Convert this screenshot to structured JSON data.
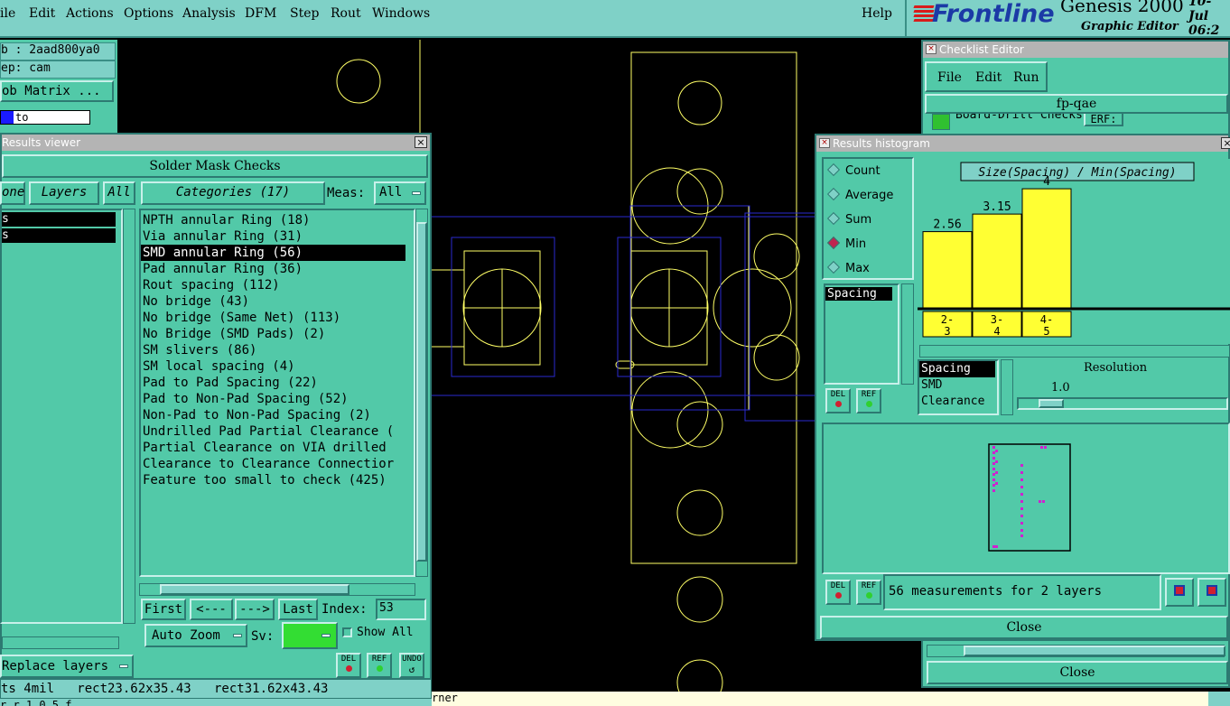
{
  "menu": {
    "items": [
      "ile",
      "Edit",
      "Actions",
      "Options",
      "Analysis",
      "DFM",
      "Step",
      "Rout",
      "Windows"
    ],
    "help": "Help"
  },
  "brand": {
    "logo": "Frontline",
    "product": "Genesis 2000",
    "subtitle": "Graphic Editor",
    "date_line1": "10-Jul",
    "date_line2": "06:2"
  },
  "left_panel": {
    "job": "b : 2aad800ya0",
    "step": "ep: cam",
    "matrix_button": "ob Matrix ...",
    "to_label": "to"
  },
  "results_viewer": {
    "title": "Results viewer",
    "heading": "Solder Mask Checks",
    "tabs": [
      "one",
      "Layers",
      "All"
    ],
    "categories_button": "Categories (17)",
    "meas_label": "Meas:",
    "meas_value": "All",
    "left_rows": [
      "s",
      "s"
    ],
    "categories": [
      "NPTH annular Ring (18)",
      "Via annular Ring (31)",
      "SMD annular Ring (56)",
      "Pad annular Ring (36)",
      "Rout spacing (112)",
      "No bridge (43)",
      "No bridge (Same Net) (113)",
      "No Bridge (SMD Pads) (2)",
      "SM slivers (86)",
      "SM local spacing (4)",
      "Pad to Pad Spacing (22)",
      "Pad to Non-Pad Spacing (52)",
      "Non-Pad to Non-Pad Spacing (2)",
      "Undrilled Pad Partial Clearance (",
      "Partial Clearance on VIA drilled",
      "Clearance to Clearance Connectior",
      "Feature too small to check (425)"
    ],
    "selected_index": 2,
    "nav": {
      "first": "First",
      "prev": "<---",
      "next": "--->",
      "last": "Last",
      "index_label": "Index:",
      "index_value": "53"
    },
    "auto_zoom": "Auto Zoom",
    "sv_label": "Sv:",
    "show_all": "Show All",
    "replace_layers": "Replace layers",
    "btn_del": "DEL",
    "btn_ref": "REF",
    "btn_undo": "UNDO"
  },
  "status": {
    "line1": "ts 4mil   rect23.62x35.43   rect31.62x43.43",
    "line2": "r    r   1   0 5 f",
    "bottom_text": "rner"
  },
  "checklist_editor": {
    "title": "Checklist Editor",
    "menu": [
      "File",
      "Edit",
      "Run"
    ],
    "name": "fp-qae",
    "row_text": "Board-Drill Checks",
    "erf": "ERF:",
    "close": "Close"
  },
  "results_histogram": {
    "title": "Results histogram",
    "modes": [
      "Count",
      "Average",
      "Sum",
      "Min",
      "Max"
    ],
    "selected_mode": "Min",
    "measure_list": [
      "Spacing"
    ],
    "attr_list": [
      "Spacing",
      "SMD",
      "Clearance"
    ],
    "resolution_label": "Resolution",
    "resolution_value": "1.0",
    "status": "56 measurements for 2 layers",
    "close": "Close",
    "btn_del": "DEL",
    "btn_ref": "REF"
  },
  "chart_data": {
    "type": "bar",
    "title": "Size(Spacing) / Min(Spacing)",
    "categories": [
      "2-3",
      "3-4",
      "4-5"
    ],
    "category_lines": [
      [
        "2-",
        "3"
      ],
      [
        "3-",
        "4"
      ],
      [
        "4-",
        "5"
      ]
    ],
    "values": [
      2.56,
      3.15,
      4
    ],
    "value_labels": [
      "2.56",
      "3.15",
      "4"
    ],
    "ylim": [
      0,
      4.7
    ],
    "bar_color": "#ffff33"
  },
  "colors": {
    "panel": "#52c9a8",
    "panel_light": "#7fd1c7",
    "canvas": "#000000",
    "feature_yellow": "#ffff66",
    "feature_blue": "#2a2ad0",
    "scatter_magenta": "#d020d0",
    "sv_green": "#33dd33"
  }
}
